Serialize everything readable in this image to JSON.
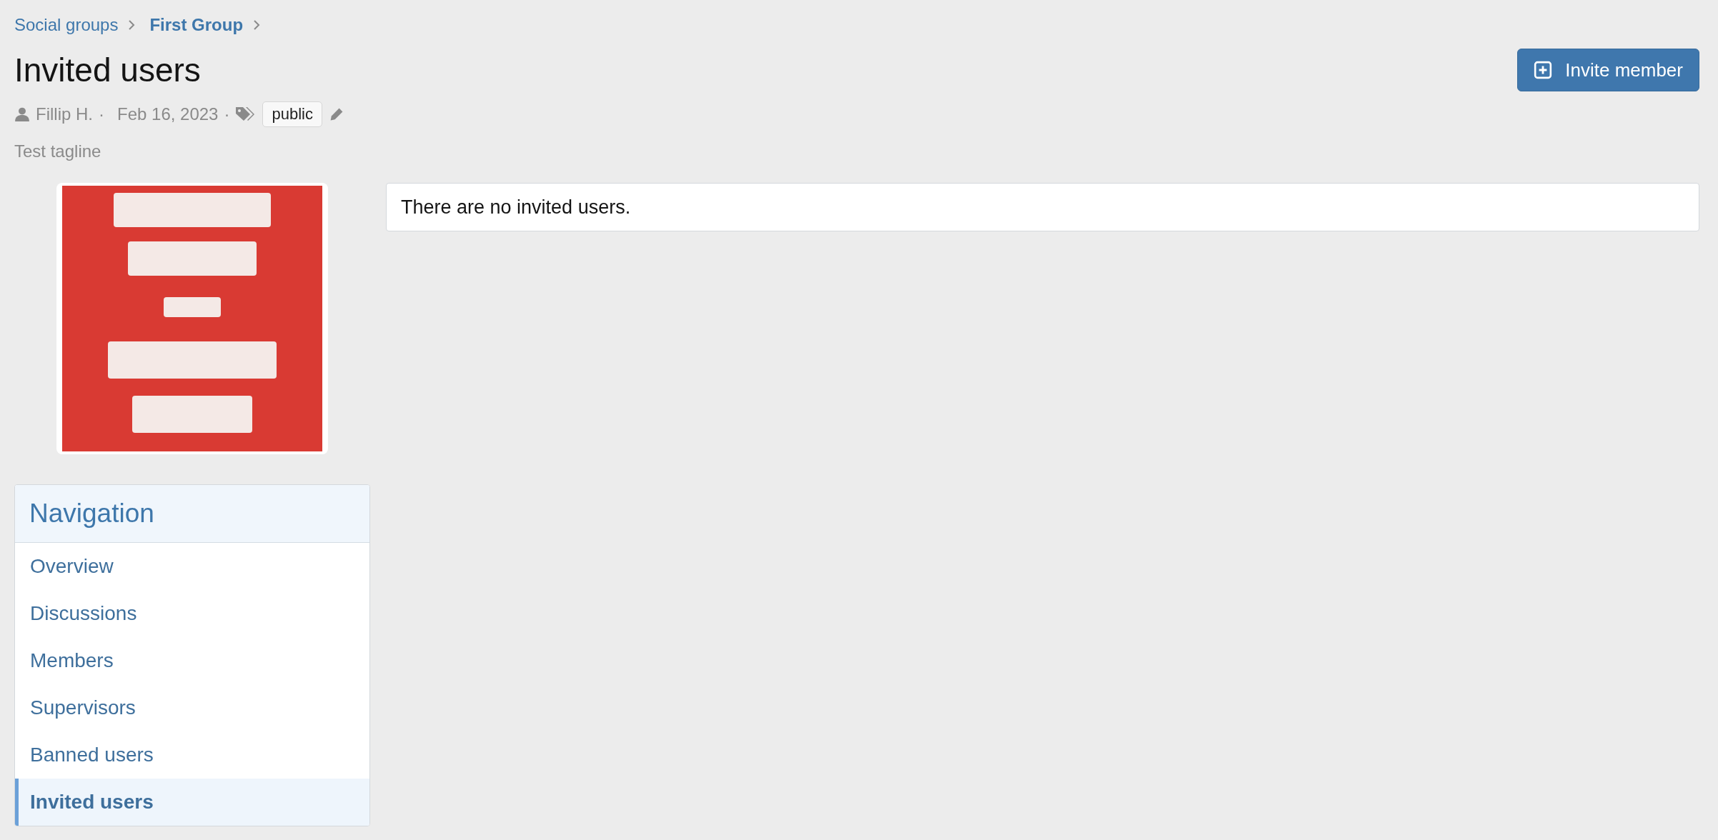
{
  "breadcrumbs": [
    {
      "label": "Social groups",
      "current": false
    },
    {
      "label": "First Group",
      "current": true
    }
  ],
  "page": {
    "title": "Invited users",
    "author": "Fillip H.",
    "separators": [
      "·",
      "·"
    ],
    "date": "Feb 16, 2023",
    "tags": [
      "public"
    ],
    "tagline": "Test tagline"
  },
  "invite_button": {
    "label": "Invite member"
  },
  "navigation": {
    "title": "Navigation",
    "items": [
      {
        "label": "Overview",
        "selected": false
      },
      {
        "label": "Discussions",
        "selected": false
      },
      {
        "label": "Members",
        "selected": false
      },
      {
        "label": "Supervisors",
        "selected": false
      },
      {
        "label": "Banned users",
        "selected": false
      },
      {
        "label": "Invited users",
        "selected": true
      }
    ]
  },
  "message": "There are no invited users."
}
